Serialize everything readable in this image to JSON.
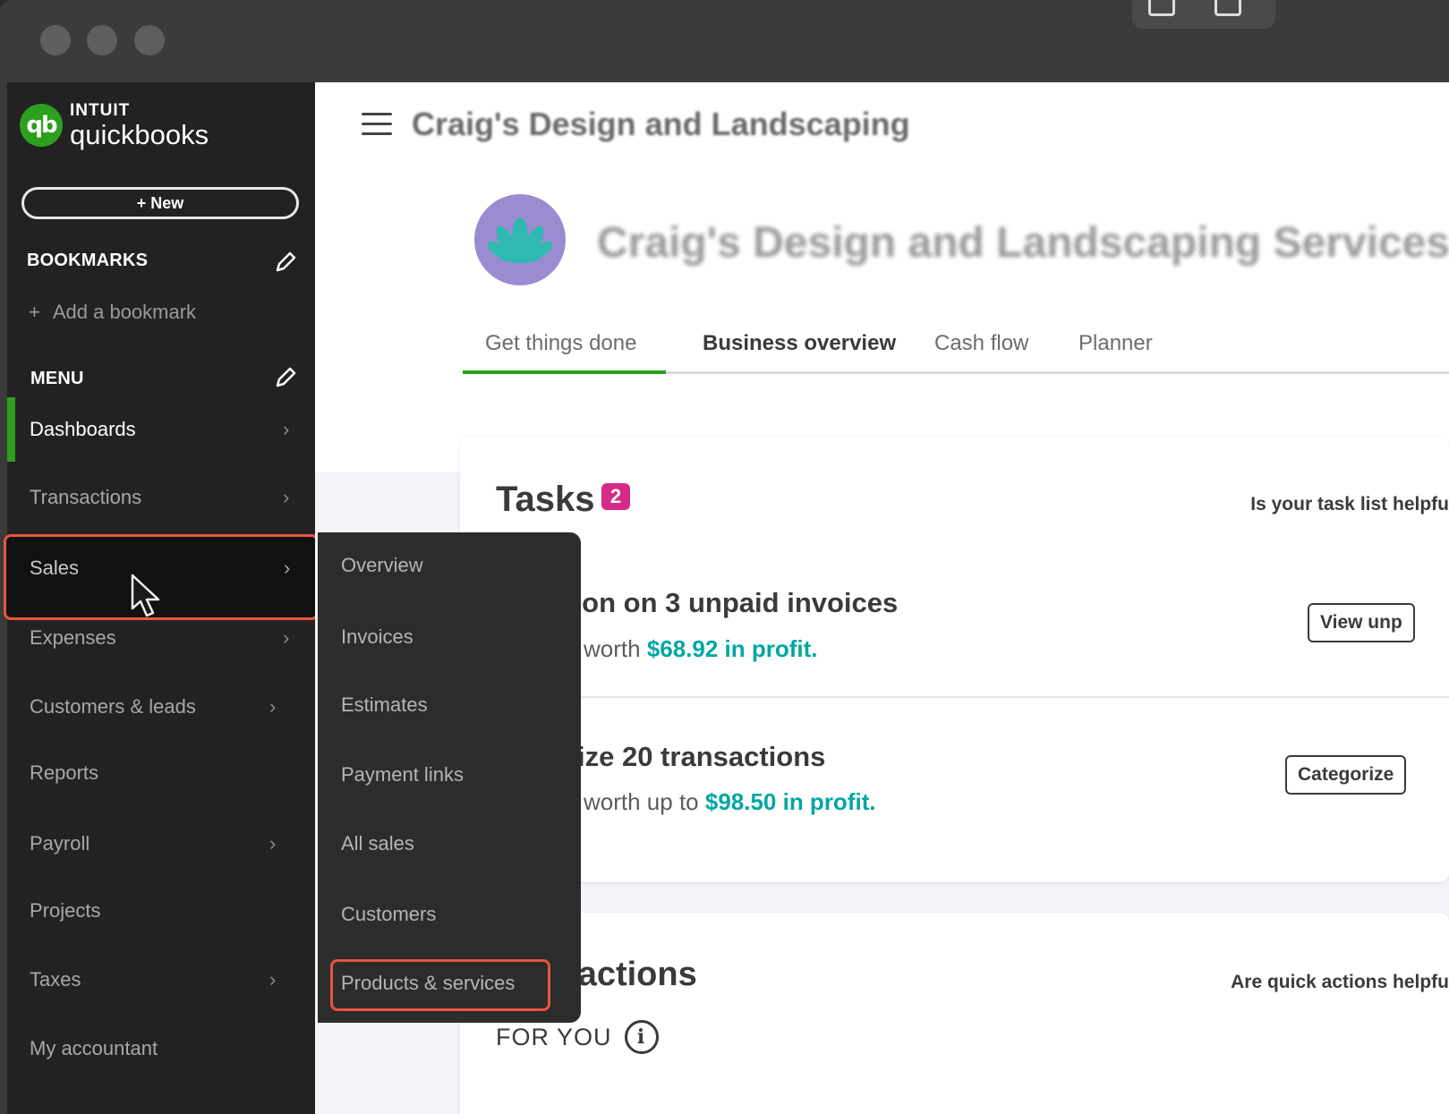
{
  "app": {
    "logo_intuit": "INTUIT",
    "logo_product": "quickbooks",
    "logo_mark": "qb",
    "new_button": "+ New"
  },
  "sidebar": {
    "bookmarks_title": "BOOKMARKS",
    "add_bookmark": "Add a bookmark",
    "menu_title": "MENU",
    "items": [
      {
        "label": "Dashboards",
        "chevron": "›"
      },
      {
        "label": "Transactions",
        "chevron": "›"
      },
      {
        "label": "Sales",
        "chevron": "›"
      },
      {
        "label": "Expenses",
        "chevron": "›"
      },
      {
        "label": "Customers & leads",
        "chevron": "›"
      },
      {
        "label": "Reports",
        "chevron": ""
      },
      {
        "label": "Payroll",
        "chevron": "›"
      },
      {
        "label": "Projects",
        "chevron": ""
      },
      {
        "label": "Taxes",
        "chevron": "›"
      },
      {
        "label": "My accountant",
        "chevron": ""
      }
    ]
  },
  "sales_menu": {
    "items": [
      "Overview",
      "Invoices",
      "Estimates",
      "Payment links",
      "All sales",
      "Customers",
      "Products & services"
    ]
  },
  "header": {
    "company_short": "Craig's Design and Landscaping",
    "company_full": "Craig's Design and Landscaping Services"
  },
  "tabs": [
    "Get things done",
    "Business overview",
    "Cash flow",
    "Planner"
  ],
  "tasks": {
    "title": "Tasks",
    "count": "2",
    "feedback": "Is your task list helpfu",
    "items": [
      {
        "title": "ction on 3 unpaid invoices",
        "sub_prefix": "worth ",
        "sub_money": "$68.92 in profit.",
        "button": "View unp"
      },
      {
        "title": "orize 20 transactions",
        "sub_prefix": "worth up to ",
        "sub_money": "$98.50 in profit.",
        "button": "Categorize"
      }
    ]
  },
  "quick_actions": {
    "title": "k actions",
    "feedback": "Are quick actions helpfu",
    "for_you": "FOR YOU",
    "info": "i"
  },
  "colors": {
    "brand_green": "#2ca01c",
    "highlight_red": "#e8553f",
    "money_teal": "#00a6a4",
    "badge_pink": "#d52b86"
  },
  "icons": {
    "hamburger": "hamburger-menu-icon",
    "pencil": "pencil-icon",
    "cursor": "mouse-cursor-icon",
    "info": "info-icon"
  }
}
